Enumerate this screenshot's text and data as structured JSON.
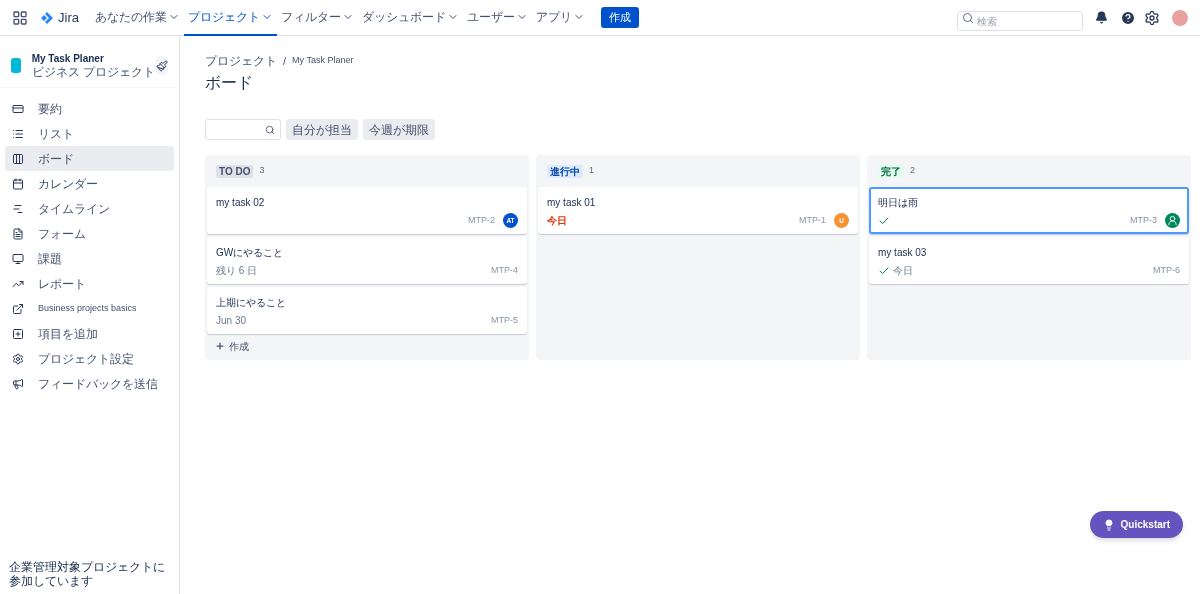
{
  "topbar": {
    "logo": "Jira",
    "menus": [
      {
        "label": "あなたの作業",
        "selected": false
      },
      {
        "label": "プロジェクト",
        "selected": true
      },
      {
        "label": "フィルター",
        "selected": false
      },
      {
        "label": "ダッシュボード",
        "selected": false
      },
      {
        "label": "ユーザー",
        "selected": false
      },
      {
        "label": "アプリ",
        "selected": false
      }
    ],
    "create": "作成",
    "search": {
      "placeholder": "検索"
    }
  },
  "sidebar": {
    "project": {
      "name": "My Task Planer",
      "type": "ビジネス プロジェクト"
    },
    "items": [
      {
        "label": "要約",
        "kind": "summary",
        "selected": false
      },
      {
        "label": "リスト",
        "kind": "list",
        "selected": false
      },
      {
        "label": "ボード",
        "kind": "board",
        "selected": true
      },
      {
        "label": "カレンダー",
        "kind": "calendar",
        "selected": false
      },
      {
        "label": "タイムライン",
        "kind": "timeline",
        "selected": false
      },
      {
        "label": "フォーム",
        "kind": "form",
        "selected": false
      },
      {
        "label": "課題",
        "kind": "issues",
        "selected": false
      },
      {
        "label": "レポート",
        "kind": "reports",
        "selected": false
      },
      {
        "label": "Business projects basics",
        "kind": "external",
        "selected": false
      },
      {
        "label": "項目を追加",
        "kind": "add",
        "selected": false
      },
      {
        "label": "プロジェクト設定",
        "kind": "settings",
        "selected": false
      },
      {
        "label": "フィードバックを送信",
        "kind": "feedback",
        "selected": false
      }
    ],
    "footer": "企業管理対象プロジェクトに参加しています"
  },
  "breadcrumb": {
    "items": [
      "プロジェクト",
      "My Task Planer"
    ],
    "separator": "/"
  },
  "title": "ボード",
  "filters": [
    "自分が担当",
    "今週が期限"
  ],
  "columns": [
    {
      "status": "TO DO",
      "kind": "todo",
      "count": "3",
      "cards": [
        {
          "title": "my task 02",
          "key": "MTP-2",
          "done": false,
          "selected": false,
          "assignee": {
            "kind": "initials",
            "text": "AT",
            "color": "#0052cc"
          }
        },
        {
          "title": "GWにやること",
          "key": "MTP-4",
          "done": false,
          "selected": false,
          "due": {
            "text": "残り 6 日",
            "overdue": false
          }
        },
        {
          "title": "上期にやること",
          "key": "MTP-5",
          "done": false,
          "selected": false,
          "due": {
            "text": "Jun 30",
            "overdue": false
          }
        }
      ],
      "create": "作成"
    },
    {
      "status": "進行中",
      "kind": "progress",
      "count": "1",
      "cards": [
        {
          "title": "my task 01",
          "key": "MTP-1",
          "done": false,
          "selected": false,
          "due": {
            "text": "今日",
            "overdue": true
          },
          "assignee": {
            "kind": "initials",
            "text": "U",
            "color": "#f79232"
          }
        }
      ]
    },
    {
      "status": "完了",
      "kind": "done",
      "count": "2",
      "cards": [
        {
          "title": "明日は雨",
          "key": "MTP-3",
          "done": true,
          "selected": true,
          "assignee": {
            "kind": "person",
            "color": "#00875a"
          }
        },
        {
          "title": "my task 03",
          "key": "MTP-6",
          "done": true,
          "selected": false,
          "due": {
            "text": "今日",
            "overdue": false
          }
        }
      ]
    }
  ],
  "quickstart": "Quickstart"
}
